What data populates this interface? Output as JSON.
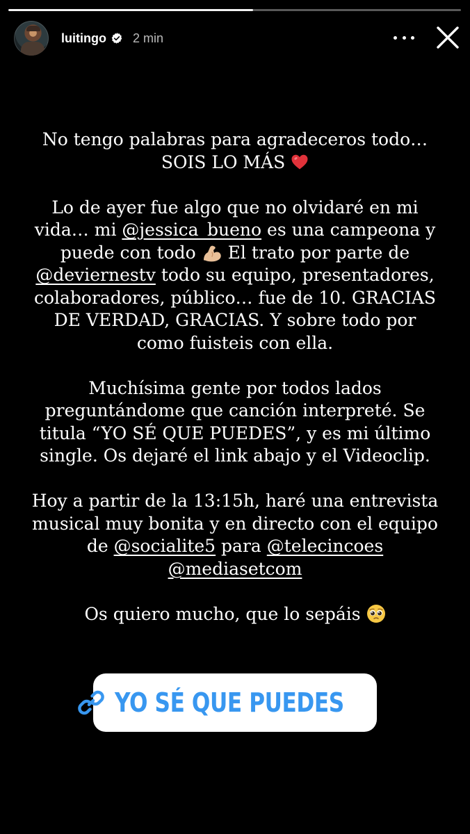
{
  "story": {
    "progress": 0.54,
    "author": {
      "username": "luitingo",
      "verified": true,
      "time": "2 min"
    },
    "header_icons": [
      "avatar",
      "verified-badge-icon",
      "more-options-icon",
      "close-icon"
    ],
    "message": {
      "p1_l1": "No tengo palabras para agradeceros todo…",
      "p1_l2": "SOIS LO MÁS",
      "p1_emoji": "red-heart-emoji",
      "p2_a": "Lo de ayer fue algo que no olvidaré en mi vida… mi ",
      "p2_mention1": "@jessica_bueno",
      "p2_b": " es una campeona y puede con todo ",
      "p2_emoji": "flexed-biceps-emoji",
      "p2_c": " El trato por parte de ",
      "p2_mention2": "@deviernestv",
      "p2_d": " todo su equipo, presentadores, colaboradores, público… fue de 10. GRACIAS DE VERDAD, GRACIAS. Y sobre todo por como fuisteis con ella.",
      "p3": "Muchísima gente por todos lados preguntándome que canción interpreté. Se titula “YO SÉ QUE PUEDES”, y es mi último single. Os dejaré el link abajo y el Videoclip.",
      "p4_a": "Hoy a partir de la 13:15h, haré una entrevista musical muy bonita y en directo con el equipo de ",
      "p4_mention1": "@socialite5",
      "p4_b": " para ",
      "p4_mention2": "@telecincoes",
      "p4_mention3": "@mediasetcom",
      "p5": "Os quiero mucho, que lo sepáis",
      "p5_emoji": "pleading-face-emoji"
    },
    "link_sticker": {
      "label": "YO SÉ QUE PUEDES",
      "icon": "link-icon",
      "color": "#3897f0"
    },
    "colors": {
      "background": "#000000",
      "text": "#ffffff",
      "sticker_bg": "#ffffff",
      "link_blue": "#3897f0",
      "verified_blue": "#ffffff"
    }
  }
}
